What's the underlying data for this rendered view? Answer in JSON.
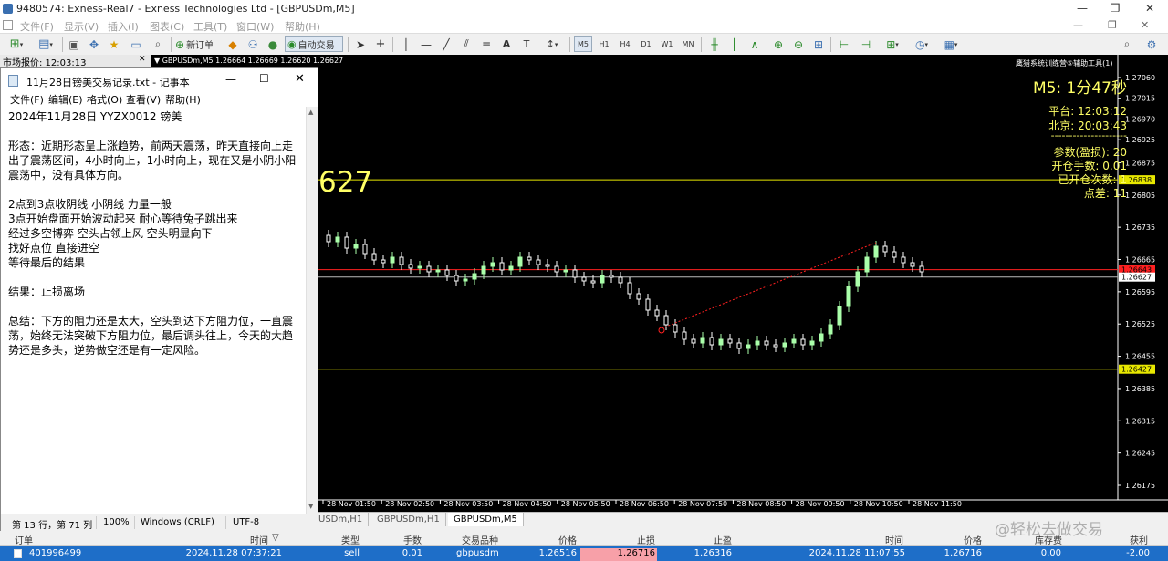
{
  "window": {
    "title": "9480574: Exness-Real7 - Exness Technologies Ltd - [GBPUSDm,M5]",
    "controls": [
      "—",
      "❐",
      "✕"
    ]
  },
  "menu": [
    "文件(F)",
    "显示(V)",
    "插入(I)",
    "图表(C)",
    "工具(T)",
    "窗口(W)",
    "帮助(H)"
  ],
  "toolbar": {
    "new_order": "新订单",
    "auto_trading": "自动交易",
    "timeframes": [
      "M5",
      "H1",
      "H4",
      "D1",
      "W1",
      "MN"
    ]
  },
  "market_watch": {
    "label": "市场报价: 12:03:13"
  },
  "chart": {
    "symbol_line": "GBPUSDm,M5  1.26664 1.26669 1.26620 1.26627",
    "indicator_name": "鹰猎系统训练营⑥辅助工具(1)",
    "big_price_fragment": "627",
    "panel": {
      "timer": "M5: 1分47秒",
      "platform_label": "平台:",
      "platform_time": "12:03:12",
      "beijing_label": "北京:",
      "beijing_time": "20:03:43",
      "divider": "---------------------",
      "param_label": "参数(盈损):",
      "param_value": "20",
      "lots_label": "开仓手数:",
      "lots_value": "0.01",
      "count_label": "已开仓次数:",
      "count_value": "1",
      "spread_label": "点差:",
      "spread_value": "11"
    },
    "price_axis": [
      "1.27060",
      "1.27015",
      "1.26970",
      "1.26925",
      "1.26875",
      "1.26805",
      "1.26735",
      "1.26665",
      "1.26595",
      "1.26525",
      "1.26455",
      "1.26385",
      "1.26315",
      "1.26245",
      "1.26175"
    ],
    "price_tags": {
      "upper": "1.26838",
      "current": "1.26627",
      "red": "1.26643",
      "lower": "1.26427"
    },
    "time_axis": [
      "28 Nov 01:50",
      "28 Nov 02:50",
      "28 Nov 03:50",
      "28 Nov 04:50",
      "28 Nov 05:50",
      "28 Nov 06:50",
      "28 Nov 07:50",
      "28 Nov 08:50",
      "28 Nov 09:50",
      "28 Nov 10:50",
      "28 Nov 11:50"
    ],
    "colors": {
      "bull": "#aaffaa",
      "bear": "#ffffff",
      "level": "#e8e800",
      "red_line": "#ff2020",
      "panel_text": "#ffff66"
    }
  },
  "notepad": {
    "title": "11月28日镑美交易记录.txt - 记事本",
    "menu": [
      "文件(F)",
      "编辑(E)",
      "格式(O)",
      "查看(V)",
      "帮助(H)"
    ],
    "lines": [
      "2024年11月28日 YYZX0012 镑美",
      "",
      "形态：近期形态呈上涨趋势，前两天震荡，昨天直接向上走出了震荡区间，4小时向上，1小时向上，现在又是小阴小阳震荡中，没有具体方向。",
      "",
      "2点到3点收阴线 小阴线 力量一般",
      "3点开始盘面开始波动起来 耐心等待兔子跳出来",
      "经过多空博弈 空头占领上风 空头明显向下",
      "找好点位 直接进空",
      "等待最后的结果",
      "",
      "结果：止损离场",
      "",
      "总结：下方的阻力还是太大，空头到达下方阻力位，一直震荡，始终无法突破下方阻力位，最后调头往上，今天的大趋势还是多头，逆势做空还是有一定风险。"
    ],
    "status": {
      "position": "第 13 行，第 71 列",
      "zoom": "100%",
      "line_ending": "Windows (CRLF)",
      "encoding": "UTF-8"
    }
  },
  "tabs": [
    "USDm,H1",
    "GBPUSDm,H1",
    "GBPUSDm,M5"
  ],
  "orders": {
    "headers": [
      "订单",
      "时间",
      "类型",
      "手数",
      "交易品种",
      "价格",
      "止损",
      "止盈",
      "时间",
      "价格",
      "库存费",
      "获利"
    ],
    "row": [
      "401996499",
      "2024.11.28 07:37:21",
      "sell",
      "0.01",
      "gbpusdm",
      "1.26516",
      "1.26716",
      "1.26316",
      "2024.11.28 11:07:55",
      "1.26716",
      "0.00",
      "-2.00"
    ]
  },
  "watermark": "@轻松去做交易"
}
